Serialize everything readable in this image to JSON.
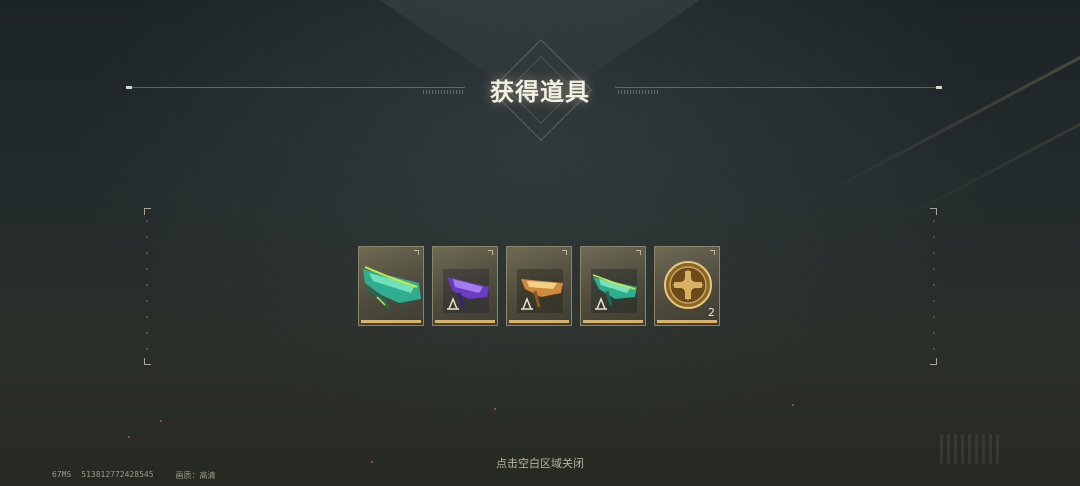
{
  "dialog": {
    "title": "获得道具",
    "close_hint": "点击空白区域关闭"
  },
  "items": [
    {
      "icon": "green-rifle-icon",
      "count": ""
    },
    {
      "icon": "purple-rifle-blueprint-icon",
      "count": ""
    },
    {
      "icon": "gold-rifle-blueprint-icon",
      "count": ""
    },
    {
      "icon": "green-rifle-blueprint-icon",
      "count": ""
    },
    {
      "icon": "gold-cross-coin-icon",
      "count": "2"
    }
  ],
  "status": {
    "ping": "67MS",
    "uid": "513812772428545",
    "quality": "画质：高清"
  },
  "colors": {
    "title": "#f3efe1",
    "item_frame": "#8c8669",
    "item_bar": "#d8b46a"
  }
}
